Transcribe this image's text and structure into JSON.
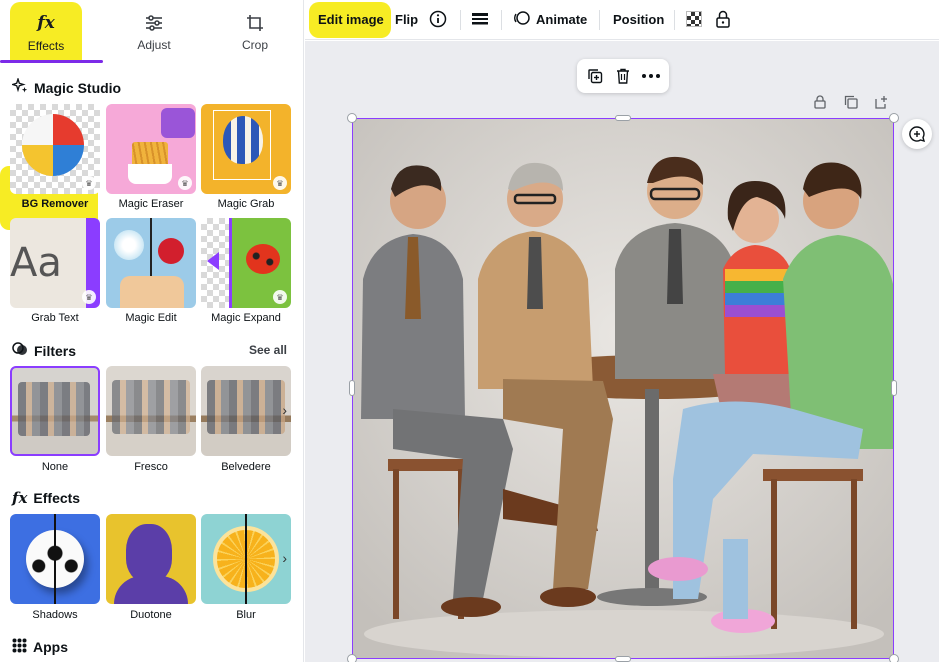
{
  "tabs": [
    {
      "label": "Effects",
      "icon": "fx-icon"
    },
    {
      "label": "Adjust",
      "icon": "sliders-icon"
    },
    {
      "label": "Crop",
      "icon": "crop-icon"
    }
  ],
  "magic_studio": {
    "heading": "Magic Studio",
    "tools": [
      {
        "label": "BG Remover",
        "icon": "beach-ball-image"
      },
      {
        "label": "Magic Eraser",
        "icon": "fries-image"
      },
      {
        "label": "Magic Grab",
        "icon": "hot-air-balloon-image"
      },
      {
        "label": "Grab Text",
        "icon": "text-aa-image"
      },
      {
        "label": "Magic Edit",
        "icon": "flowers-image"
      },
      {
        "label": "Magic Expand",
        "icon": "ladybug-image"
      }
    ]
  },
  "filters": {
    "heading": "Filters",
    "see_all": "See all",
    "items": [
      {
        "label": "None"
      },
      {
        "label": "Fresco"
      },
      {
        "label": "Belvedere"
      }
    ]
  },
  "effects": {
    "heading": "Effects",
    "items": [
      {
        "label": "Shadows",
        "icon": "soccer-ball-image"
      },
      {
        "label": "Duotone",
        "icon": "portrait-image"
      },
      {
        "label": "Blur",
        "icon": "orange-slice-image"
      }
    ]
  },
  "apps": {
    "heading": "Apps"
  },
  "toolbar": {
    "edit_image": "Edit image",
    "flip": "Flip",
    "animate": "Animate",
    "position": "Position"
  },
  "colors": {
    "accent": "#8b3dff",
    "highlight": "#f7ec24",
    "canvas_bg": "#ebecf0"
  }
}
